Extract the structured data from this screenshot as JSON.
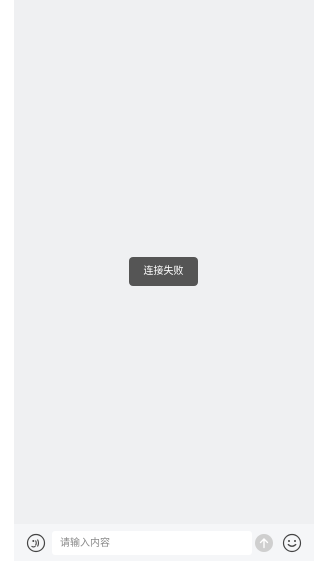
{
  "toast": {
    "message": "连接失败"
  },
  "composer": {
    "input_placeholder": "请输入内容",
    "input_value": "",
    "left_icon": "voice-face-icon",
    "send_icon": "arrow-up-icon",
    "emoji_icon": "smiley-icon"
  },
  "colors": {
    "chat_background": "#eff0f2",
    "toast_background": "#555555",
    "send_disabled": "#cfcfcf",
    "icon_stroke": "#444444"
  }
}
